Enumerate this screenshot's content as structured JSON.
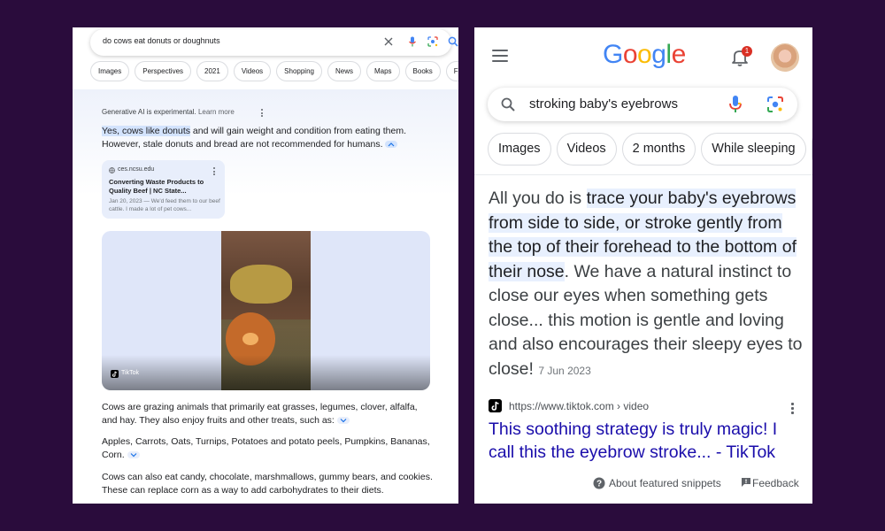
{
  "left": {
    "search_query": "do cows eat donuts or doughnuts",
    "chips": [
      "Images",
      "Perspectives",
      "2021",
      "Videos",
      "Shopping",
      "News",
      "Maps",
      "Books",
      "Flights"
    ],
    "ai_label": "Generative AI is experimental.",
    "learn_more": "Learn more",
    "answer_highlight": "Yes, cows like donuts",
    "answer_rest": " and will gain weight and condition from eating them. However, stale donuts and bread are not recommended for humans.",
    "source_site": "ces.ncsu.edu",
    "source_title": "Converting Waste Products to Quality Beef | NC State...",
    "source_snippet": "Jan 20, 2023 — We'd feed them to our beef cattle. I made a lot of pet cows...",
    "video_source": "TikTok",
    "para2": "Cows are grazing animals that primarily eat grasses, legumes, clover, alfalfa, and hay. They also enjoy fruits and other treats, such as:",
    "para3": "Apples, Carrots, Oats, Turnips, Potatoes and potato peels, Pumpkins, Bananas, Corn.",
    "para4": "Cows can also eat candy, chocolate, marshmallows, gummy bears, and cookies. These can replace corn as a way to add carbohydrates to their diets."
  },
  "right": {
    "logo": "Google",
    "notification_count": "1",
    "search_query": "stroking baby's eyebrows",
    "chips": [
      "Images",
      "Videos",
      "2 months",
      "While sleeping"
    ],
    "snippet_pre": "All you do is ",
    "snippet_highlight": "trace your baby's eyebrows from side to side, or stroke gently from the top of their forehead to the bottom of their nose",
    "snippet_post": ". We have a natural instinct to close our eyes when something gets close... this motion is gentle and loving and also encourages their sleepy eyes to close!",
    "snippet_date": "7 Jun 2023",
    "source_url": "https://www.tiktok.com › video",
    "result_title": "This soothing strategy is truly magic! I call this the eyebrow stroke... - TikTok",
    "about_snippets": "About featured snippets",
    "feedback": "Feedback"
  },
  "colors": {
    "background": "#2a0c3c",
    "highlight_left": "#d3e3fd",
    "highlight_right": "#e8f0fe",
    "link": "#1a0dab",
    "google_blue": "#4285f4",
    "google_red": "#ea4335",
    "google_yellow": "#fbbc05",
    "google_green": "#34a853"
  },
  "icons": [
    "close-icon",
    "mic-icon",
    "lens-icon",
    "search-icon",
    "more-vert-icon",
    "globe-icon",
    "tiktok-icon",
    "menu-icon",
    "bell-icon",
    "help-icon",
    "feedback-icon",
    "chevron-up-icon",
    "chevron-down-icon"
  ]
}
